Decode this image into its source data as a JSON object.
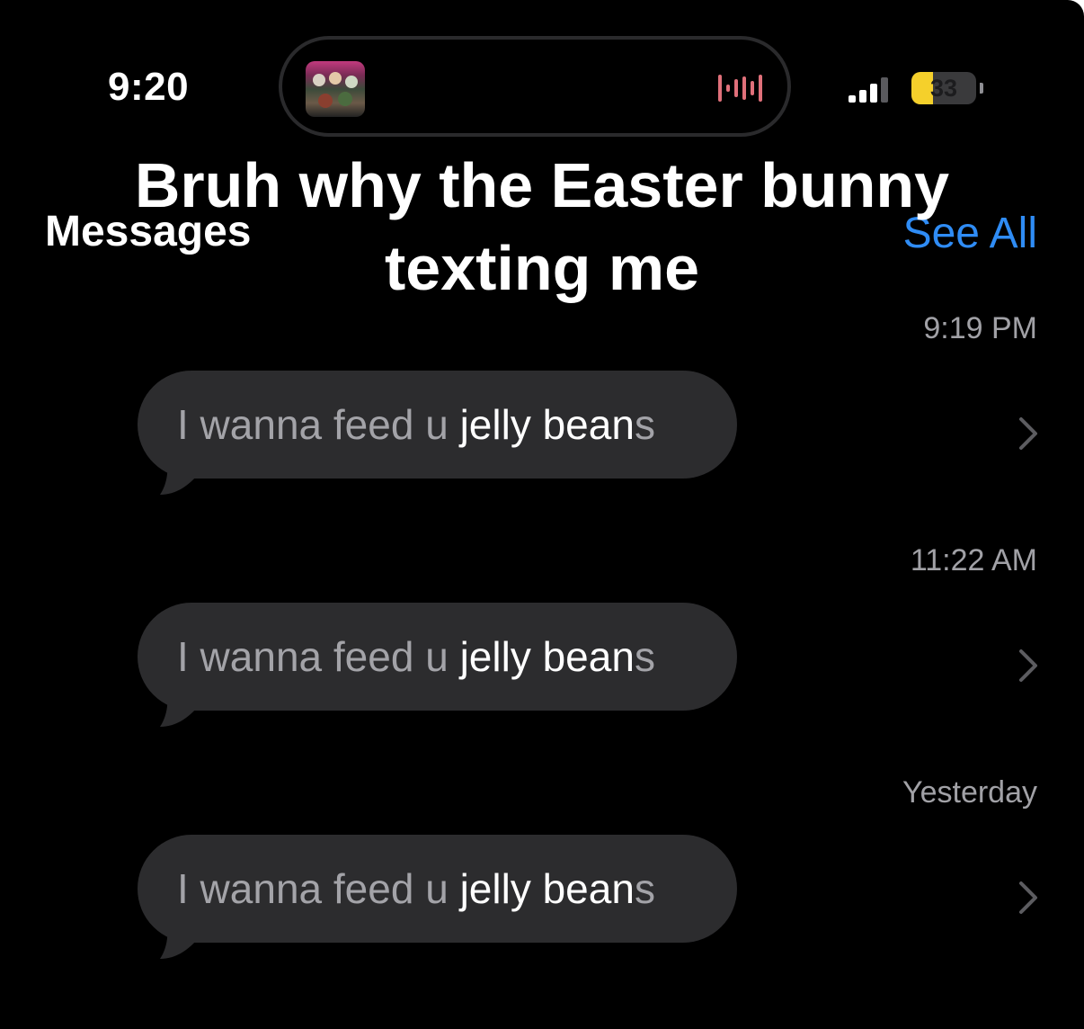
{
  "status_bar": {
    "time": "9:20",
    "battery_level": "33",
    "battery_fraction": 0.33,
    "signal_bars_active": 3
  },
  "caption": {
    "line1": "Bruh why the Easter bunny",
    "line2": "texting me"
  },
  "header": {
    "title": "Messages",
    "see_all": "See All"
  },
  "colors": {
    "background": "#000000",
    "bubble": "#2c2c2e",
    "accent_link": "#2f8cf5",
    "battery": "#f5d02b",
    "secondary_text": "#a1a1a6"
  },
  "messages": [
    {
      "time": "9:19 PM",
      "dim_text": "I wanna feed u ",
      "bright_text": "jelly bean",
      "tail_text": "s"
    },
    {
      "time": "11:22 AM",
      "dim_text": "I wanna feed u ",
      "bright_text": "jelly bean",
      "tail_text": "s"
    },
    {
      "time": "Yesterday",
      "dim_text": "I wanna feed u ",
      "bright_text": "jelly bean",
      "tail_text": "s"
    }
  ],
  "icons": {
    "island_artwork": "album-art-icon",
    "island_wave": "audio-waveform-icon",
    "signal": "cellular-signal-icon",
    "battery": "battery-icon",
    "row_chevron": "chevron-right-icon"
  }
}
